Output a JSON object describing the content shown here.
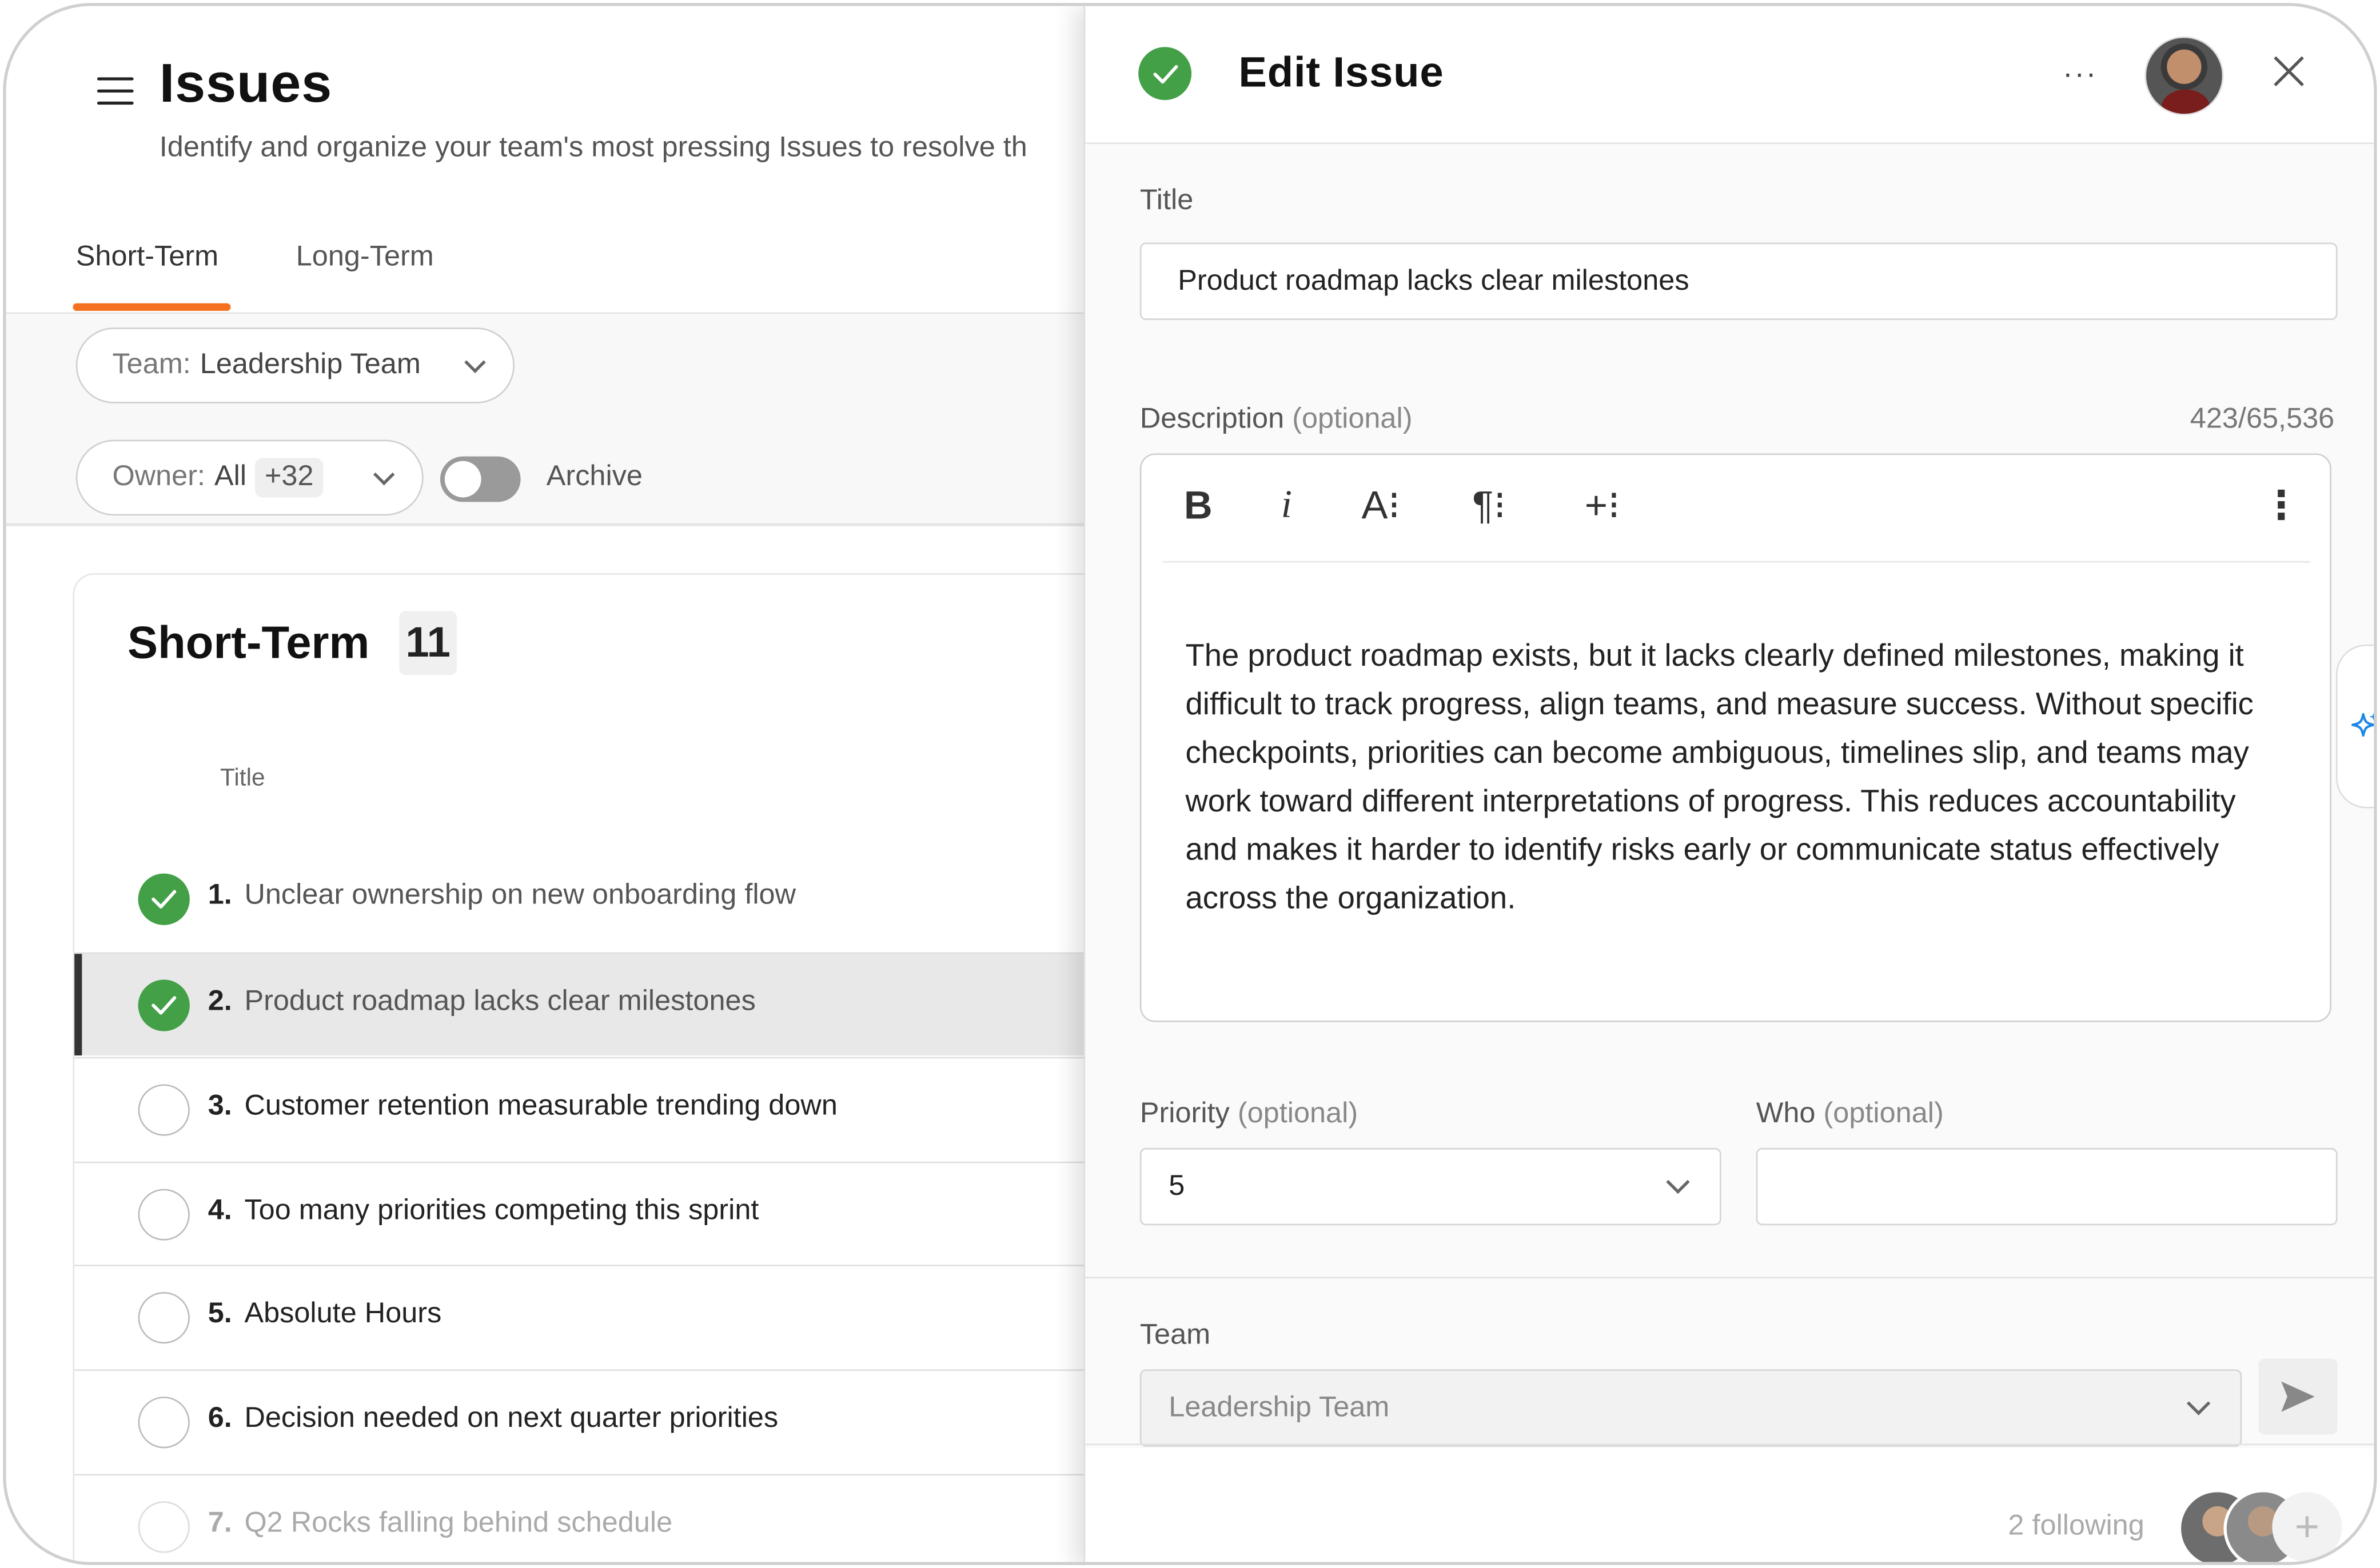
{
  "issues_page": {
    "title": "Issues",
    "subtitle": "Identify and organize your team's most pressing Issues to resolve th",
    "tabs": [
      {
        "label": "Short-Term",
        "active": true
      },
      {
        "label": "Long-Term",
        "active": false
      }
    ],
    "filters": {
      "team_key": "Team:",
      "team_value": "Leadership Team",
      "owner_key": "Owner:",
      "owner_value": "All",
      "owner_more": "+32",
      "archive_label": "Archive",
      "archive_on": false
    },
    "list": {
      "title": "Short-Term",
      "count": "11",
      "column_title": "Title",
      "items": [
        {
          "num": "1.",
          "label": "Unclear ownership on new onboarding flow",
          "done": true
        },
        {
          "num": "2.",
          "label": "Product roadmap lacks clear milestones",
          "done": true,
          "selected": true
        },
        {
          "num": "3.",
          "label": "Customer retention measurable trending down",
          "done": false
        },
        {
          "num": "4.",
          "label": "Too many priorities competing this sprint",
          "done": false
        },
        {
          "num": "5.",
          "label": "Absolute Hours",
          "done": false
        },
        {
          "num": "6.",
          "label": "Decision needed on next quarter priorities",
          "done": false
        },
        {
          "num": "7.",
          "label": "Q2 Rocks falling behind schedule",
          "done": false
        }
      ]
    }
  },
  "edit_panel": {
    "title": "Edit Issue",
    "more_label": "···",
    "fields": {
      "title_label": "Title",
      "title_value": "Product roadmap lacks clear milestones",
      "description_label": "Description",
      "optional": "(optional)",
      "description_counter": "423/65,536",
      "description_value": "The product roadmap exists, but it lacks clearly defined milestones, making it difficult to track progress, align teams, and measure success. Without specific checkpoints, priorities can become ambiguous, timelines slip, and teams may work toward different interpretations of progress. This reduces accountability and makes it harder to identify risks early or communicate status effectively across the organization.",
      "priority_label": "Priority",
      "priority_value": "5",
      "who_label": "Who",
      "who_value": "",
      "team_label": "Team",
      "team_value": "Leadership Team"
    },
    "toolbar": {
      "bold": "B",
      "italic": "i",
      "font": "A⁝",
      "paragraph": "¶⁝",
      "insert": "+⁝",
      "more": "⋮"
    },
    "footer": {
      "following": "2 following",
      "add": "+"
    }
  },
  "colors": {
    "accent_orange": "#f5711f",
    "success_green": "#43a047"
  },
  "icons": [
    "menu-icon",
    "check-icon",
    "chevron-down-icon",
    "close-icon",
    "more-icon",
    "send-icon",
    "sparkle-icon",
    "plus-icon"
  ]
}
